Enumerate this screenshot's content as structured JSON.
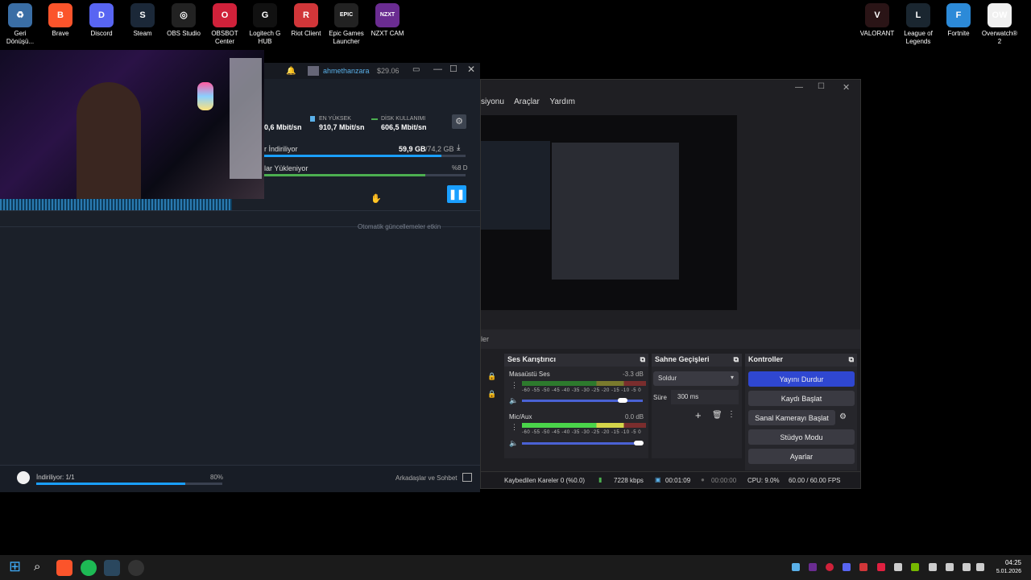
{
  "desktop_left": [
    {
      "label": "Geri Dönüşü...",
      "color": "#3a6ea5",
      "glyph": "♻"
    },
    {
      "label": "Brave",
      "color": "#fb542b",
      "glyph": "B"
    },
    {
      "label": "Discord",
      "color": "#5865f2",
      "glyph": "D"
    },
    {
      "label": "Steam",
      "color": "#1b2838",
      "glyph": "S"
    },
    {
      "label": "OBS Studio",
      "color": "#222",
      "glyph": "◎"
    },
    {
      "label": "OBSBOT Center",
      "color": "#d0213a",
      "glyph": "O"
    },
    {
      "label": "Logitech G HUB",
      "color": "#111",
      "glyph": "G"
    },
    {
      "label": "Riot Client",
      "color": "#d13639",
      "glyph": "R"
    },
    {
      "label": "Epic Games Launcher",
      "color": "#222",
      "glyph": "EPIC"
    },
    {
      "label": "NZXT CAM",
      "color": "#6a2c91",
      "glyph": "NZXT"
    }
  ],
  "desktop_right": [
    {
      "label": "VALORANT",
      "color": "#2a1416",
      "glyph": "V"
    },
    {
      "label": "League of Legends",
      "color": "#1a2630",
      "glyph": "L"
    },
    {
      "label": "Fortnite",
      "color": "#2c8ad8",
      "glyph": "F"
    },
    {
      "label": "Overwatch® 2",
      "color": "#f0f0f0",
      "glyph": "OW"
    }
  ],
  "steam": {
    "user": "ahmethanzara",
    "balance": "$29.06",
    "peak_label": "EN YÜKSEK",
    "peak_value": "910,7 Mbit/sn",
    "disk_label": "DİSK KULLANIMI",
    "disk_value": "606,5 Mbit/sn",
    "current_value": "0,6 Mbit/sn",
    "downloading_label": "r İndiriliyor",
    "downloading_size": "59,9 GB",
    "downloading_total": "/74,2 GB",
    "download_fraction": 0.88,
    "uploading_label": "lar Yükleniyor",
    "uploading_pct": "%8 D",
    "upload_fraction": 0.8,
    "auto_updates": "Otomatik güncellemeler etkin",
    "footer_status": "İndiriliyor: 1/1",
    "footer_pct": "80%",
    "footer_fraction": 0.8,
    "friends": "Arkadaşlar ve Sohbet"
  },
  "obs": {
    "menu": [
      "siyonu",
      "Araçlar",
      "Yardım"
    ],
    "scenes_partial": "ler",
    "audio_title": "Ses Karıştırıcı",
    "desktop_audio": "Masaüstü Ses",
    "desktop_db": "-3.3 dB",
    "mic": "Mic/Aux",
    "mic_db": "0.0 dB",
    "ticks": "-60 -55 -50 -45 -40 -35 -30 -25 -20 -15 -10 -5 0",
    "transitions_title": "Sahne Geçişleri",
    "transition": "Soldur",
    "duration_label": "Süre",
    "duration": "300 ms",
    "controls_title": "Kontroller",
    "stop_stream": "Yayını Durdur",
    "start_rec": "Kaydı Başlat",
    "virtual_cam": "Sanal Kamerayı Başlat",
    "studio_mode": "Stüdyo Modu",
    "settings": "Ayarlar",
    "dropped": "Kaybedilen Kareler 0 (%0.0)",
    "bitrate": "7228 kbps",
    "live_time": "00:01:09",
    "rec_time": "00:00:00",
    "cpu": "CPU: 9.0%",
    "fps": "60.00 / 60.00 FPS"
  },
  "taskbar": {
    "time": "04:25",
    "date": "5.01.2026"
  }
}
